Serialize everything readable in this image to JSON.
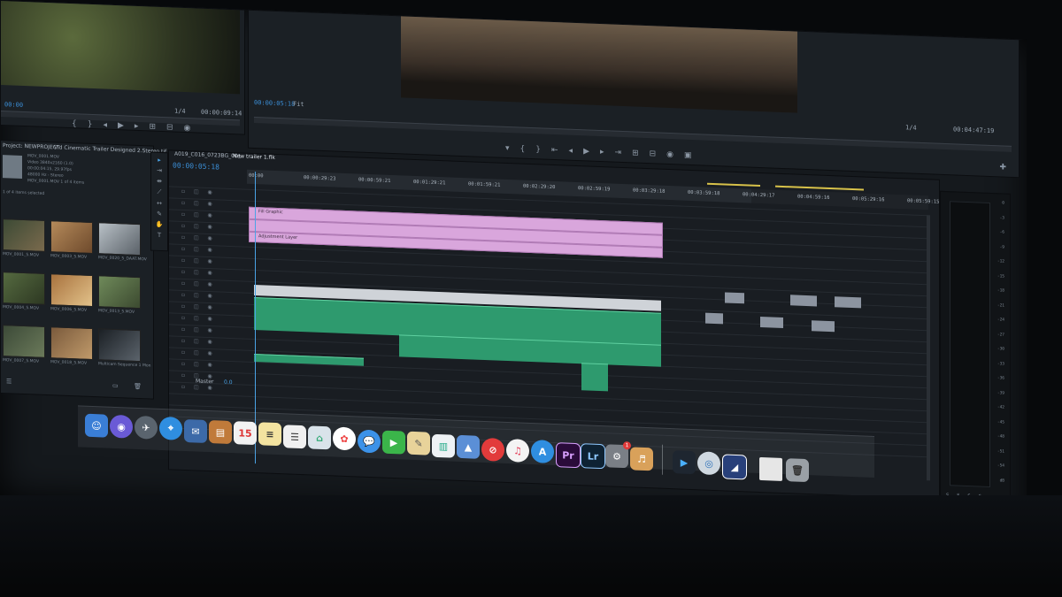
{
  "source_monitor": {
    "timecode_left": "00:00",
    "timecode_right": "00:00:09:14",
    "zoom": "1/4"
  },
  "program_monitor": {
    "timecode": "00:00:05:18",
    "fit": "Fit",
    "zoom": "1/4",
    "duration": "00:04:47:19"
  },
  "project_panel": {
    "tab_project": "Project: NEWPROJECT",
    "tab_media": "Vid Cinematic Trailer Designed 2.Stereo.tif",
    "info_lines": [
      "MOV_0001.MOV",
      "Video 3840x2160 (1.0)",
      "00:00:04:15, 29.97fps",
      "48000 Hz - Stereo",
      "MOV_0001.MOV 1 of 4 items"
    ],
    "selected_label": "1 of 4 items selected",
    "thumbnails": [
      {
        "label": "MOV_0001_5.MOV",
        "colors": [
          "#3c4a35",
          "#7a6a4d"
        ]
      },
      {
        "label": "MOV_0003_5.MOV",
        "colors": [
          "#b58a5a",
          "#6e4a2c"
        ]
      },
      {
        "label": "MOV_0020_5_DAAT.MOV",
        "colors": [
          "#b8c0c6",
          "#5a6168"
        ]
      },
      {
        "label": "MOV_0004_5.MOV",
        "colors": [
          "#556a40",
          "#2d3822"
        ]
      },
      {
        "label": "MOV_0006_5.MOV",
        "colors": [
          "#a8723e",
          "#e2c28a"
        ]
      },
      {
        "label": "MOV_0013_5.MOV",
        "colors": [
          "#6f8a5a",
          "#3c4a30"
        ]
      },
      {
        "label": "MOV_0007_5.MOV",
        "colors": [
          "#3c4a38",
          "#6b7a5a"
        ]
      },
      {
        "label": "MOV_0018_5.MOV",
        "colors": [
          "#7a5a3c",
          "#c09a6a"
        ]
      },
      {
        "label": "Multicam Sequence 1 Mon",
        "colors": [
          "#1b2025",
          "#5b636b"
        ]
      }
    ]
  },
  "timeline": {
    "tab_1": "A019_C016_0723BG_001",
    "tab_2": "New trailer 1.flk",
    "timecode": "00:00:05:18",
    "ruler_ticks": [
      "00:00",
      "00:00:29:23",
      "00:00:59:21",
      "00:01:29:21",
      "00:01:59:21",
      "00:02:29:20",
      "00:02:59:19",
      "00:03:29:18",
      "00:03:59:18",
      "00:04:29:17",
      "00:04:59:16",
      "00:05:29:16",
      "00:05:59:15"
    ],
    "clip_labels": [
      "Fill Graphic",
      "Adjustment Layer"
    ],
    "track_master": "Master",
    "track_master_value": "0.0"
  },
  "meters": {
    "scale": [
      "0",
      "-3",
      "-6",
      "-9",
      "-12",
      "-15",
      "-18",
      "-21",
      "-24",
      "-27",
      "-30",
      "-33",
      "-36",
      "-39",
      "-42",
      "-45",
      "-48",
      "-51",
      "-54",
      "dB"
    ],
    "footer": [
      "S",
      "S",
      "S",
      "S"
    ]
  },
  "dock": {
    "calendar_day": "15",
    "premiere_label": "Pr",
    "lightroom_label": "Lr",
    "settings_badge": "1"
  }
}
